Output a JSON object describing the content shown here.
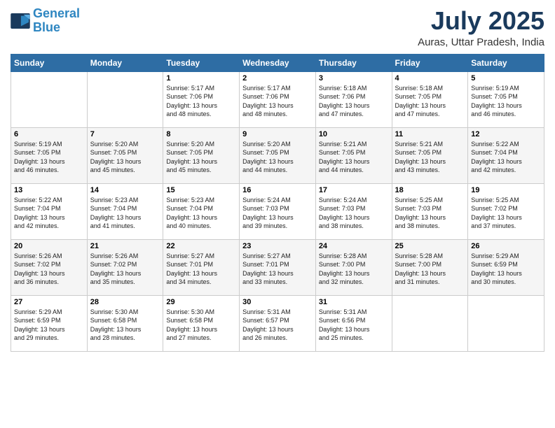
{
  "logo": {
    "line1": "General",
    "line2": "Blue"
  },
  "header": {
    "month": "July 2025",
    "location": "Auras, Uttar Pradesh, India"
  },
  "weekdays": [
    "Sunday",
    "Monday",
    "Tuesday",
    "Wednesday",
    "Thursday",
    "Friday",
    "Saturday"
  ],
  "weeks": [
    [
      {
        "day": "",
        "info": ""
      },
      {
        "day": "",
        "info": ""
      },
      {
        "day": "1",
        "info": "Sunrise: 5:17 AM\nSunset: 7:06 PM\nDaylight: 13 hours\nand 48 minutes."
      },
      {
        "day": "2",
        "info": "Sunrise: 5:17 AM\nSunset: 7:06 PM\nDaylight: 13 hours\nand 48 minutes."
      },
      {
        "day": "3",
        "info": "Sunrise: 5:18 AM\nSunset: 7:06 PM\nDaylight: 13 hours\nand 47 minutes."
      },
      {
        "day": "4",
        "info": "Sunrise: 5:18 AM\nSunset: 7:05 PM\nDaylight: 13 hours\nand 47 minutes."
      },
      {
        "day": "5",
        "info": "Sunrise: 5:19 AM\nSunset: 7:05 PM\nDaylight: 13 hours\nand 46 minutes."
      }
    ],
    [
      {
        "day": "6",
        "info": "Sunrise: 5:19 AM\nSunset: 7:05 PM\nDaylight: 13 hours\nand 46 minutes."
      },
      {
        "day": "7",
        "info": "Sunrise: 5:20 AM\nSunset: 7:05 PM\nDaylight: 13 hours\nand 45 minutes."
      },
      {
        "day": "8",
        "info": "Sunrise: 5:20 AM\nSunset: 7:05 PM\nDaylight: 13 hours\nand 45 minutes."
      },
      {
        "day": "9",
        "info": "Sunrise: 5:20 AM\nSunset: 7:05 PM\nDaylight: 13 hours\nand 44 minutes."
      },
      {
        "day": "10",
        "info": "Sunrise: 5:21 AM\nSunset: 7:05 PM\nDaylight: 13 hours\nand 44 minutes."
      },
      {
        "day": "11",
        "info": "Sunrise: 5:21 AM\nSunset: 7:05 PM\nDaylight: 13 hours\nand 43 minutes."
      },
      {
        "day": "12",
        "info": "Sunrise: 5:22 AM\nSunset: 7:04 PM\nDaylight: 13 hours\nand 42 minutes."
      }
    ],
    [
      {
        "day": "13",
        "info": "Sunrise: 5:22 AM\nSunset: 7:04 PM\nDaylight: 13 hours\nand 42 minutes."
      },
      {
        "day": "14",
        "info": "Sunrise: 5:23 AM\nSunset: 7:04 PM\nDaylight: 13 hours\nand 41 minutes."
      },
      {
        "day": "15",
        "info": "Sunrise: 5:23 AM\nSunset: 7:04 PM\nDaylight: 13 hours\nand 40 minutes."
      },
      {
        "day": "16",
        "info": "Sunrise: 5:24 AM\nSunset: 7:03 PM\nDaylight: 13 hours\nand 39 minutes."
      },
      {
        "day": "17",
        "info": "Sunrise: 5:24 AM\nSunset: 7:03 PM\nDaylight: 13 hours\nand 38 minutes."
      },
      {
        "day": "18",
        "info": "Sunrise: 5:25 AM\nSunset: 7:03 PM\nDaylight: 13 hours\nand 38 minutes."
      },
      {
        "day": "19",
        "info": "Sunrise: 5:25 AM\nSunset: 7:02 PM\nDaylight: 13 hours\nand 37 minutes."
      }
    ],
    [
      {
        "day": "20",
        "info": "Sunrise: 5:26 AM\nSunset: 7:02 PM\nDaylight: 13 hours\nand 36 minutes."
      },
      {
        "day": "21",
        "info": "Sunrise: 5:26 AM\nSunset: 7:02 PM\nDaylight: 13 hours\nand 35 minutes."
      },
      {
        "day": "22",
        "info": "Sunrise: 5:27 AM\nSunset: 7:01 PM\nDaylight: 13 hours\nand 34 minutes."
      },
      {
        "day": "23",
        "info": "Sunrise: 5:27 AM\nSunset: 7:01 PM\nDaylight: 13 hours\nand 33 minutes."
      },
      {
        "day": "24",
        "info": "Sunrise: 5:28 AM\nSunset: 7:00 PM\nDaylight: 13 hours\nand 32 minutes."
      },
      {
        "day": "25",
        "info": "Sunrise: 5:28 AM\nSunset: 7:00 PM\nDaylight: 13 hours\nand 31 minutes."
      },
      {
        "day": "26",
        "info": "Sunrise: 5:29 AM\nSunset: 6:59 PM\nDaylight: 13 hours\nand 30 minutes."
      }
    ],
    [
      {
        "day": "27",
        "info": "Sunrise: 5:29 AM\nSunset: 6:59 PM\nDaylight: 13 hours\nand 29 minutes."
      },
      {
        "day": "28",
        "info": "Sunrise: 5:30 AM\nSunset: 6:58 PM\nDaylight: 13 hours\nand 28 minutes."
      },
      {
        "day": "29",
        "info": "Sunrise: 5:30 AM\nSunset: 6:58 PM\nDaylight: 13 hours\nand 27 minutes."
      },
      {
        "day": "30",
        "info": "Sunrise: 5:31 AM\nSunset: 6:57 PM\nDaylight: 13 hours\nand 26 minutes."
      },
      {
        "day": "31",
        "info": "Sunrise: 5:31 AM\nSunset: 6:56 PM\nDaylight: 13 hours\nand 25 minutes."
      },
      {
        "day": "",
        "info": ""
      },
      {
        "day": "",
        "info": ""
      }
    ]
  ]
}
